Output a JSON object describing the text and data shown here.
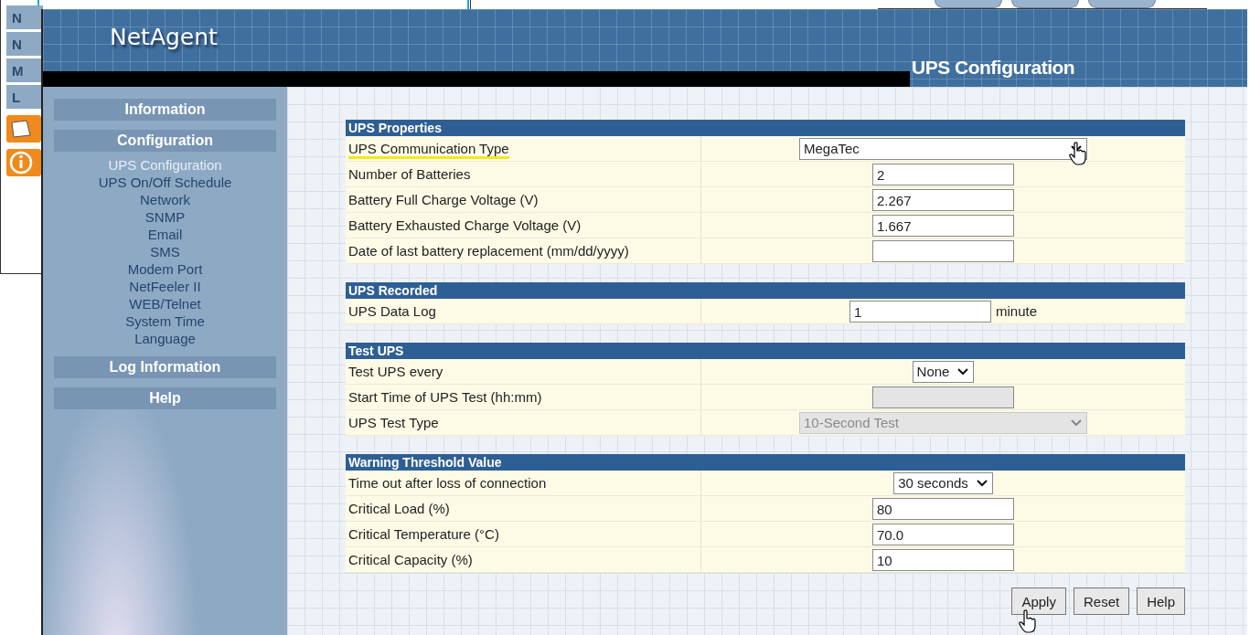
{
  "back_window": {
    "side_items": [
      "N",
      "N",
      "M",
      "L"
    ]
  },
  "header": {
    "logo": "NetAgent",
    "title": "UPS Configuration"
  },
  "sidebar": [
    {
      "label": "Information"
    },
    {
      "label": "Configuration",
      "children": [
        {
          "label": "UPS Configuration",
          "selected": true
        },
        {
          "label": "UPS On/Off Schedule",
          "selected": false
        },
        {
          "label": "Network",
          "selected": false
        },
        {
          "label": "SNMP",
          "selected": false
        },
        {
          "label": "Email",
          "selected": false
        },
        {
          "label": "SMS",
          "selected": false
        },
        {
          "label": "Modem Port",
          "selected": false
        },
        {
          "label": "NetFeeler II",
          "selected": false
        },
        {
          "label": "WEB/Telnet",
          "selected": false
        },
        {
          "label": "System Time",
          "selected": false
        },
        {
          "label": "Language",
          "selected": false
        }
      ]
    },
    {
      "label": "Log Information"
    },
    {
      "label": "Help"
    }
  ],
  "sections": [
    {
      "title": "UPS Properties",
      "rows": [
        {
          "label": "UPS Communication Type",
          "kind": "combo",
          "value": "MegaTec",
          "disabled": false,
          "underlined": true
        },
        {
          "label": "Number of Batteries",
          "kind": "input",
          "value": "2",
          "disabled": false,
          "underlined": false
        },
        {
          "label": "Battery Full Charge Voltage (V)",
          "kind": "input",
          "value": "2.267",
          "disabled": false,
          "underlined": false
        },
        {
          "label": "Battery Exhausted Charge Voltage (V)",
          "kind": "input",
          "value": "1.667",
          "disabled": false,
          "underlined": false
        },
        {
          "label": "Date of last battery replacement (mm/dd/yyyy)",
          "kind": "input",
          "value": "",
          "disabled": false,
          "underlined": false
        }
      ]
    },
    {
      "title": "UPS Recorded",
      "rows": [
        {
          "label": "UPS Data Log",
          "kind": "input",
          "value": "1",
          "unit": "minute",
          "disabled": false,
          "underlined": false
        }
      ]
    },
    {
      "title": "Test UPS",
      "rows": [
        {
          "label": "Test UPS every",
          "kind": "select",
          "value": "None",
          "disabled": false,
          "underlined": false
        },
        {
          "label": "Start Time of UPS Test (hh:mm)",
          "kind": "input",
          "value": "",
          "disabled": true,
          "underlined": false
        },
        {
          "label": "UPS Test Type",
          "kind": "combo",
          "value": "10-Second Test",
          "disabled": true,
          "underlined": false
        }
      ]
    },
    {
      "title": "Warning Threshold Value",
      "rows": [
        {
          "label": "Time out after loss of connection",
          "kind": "select",
          "value": "30 seconds",
          "disabled": false,
          "underlined": false
        },
        {
          "label": "Critical Load (%)",
          "kind": "input",
          "value": "80",
          "disabled": false,
          "underlined": false
        },
        {
          "label": "Critical Temperature (°C)",
          "kind": "input",
          "value": "70.0",
          "disabled": false,
          "underlined": false
        },
        {
          "label": "Critical Capacity (%)",
          "kind": "input",
          "value": "10",
          "disabled": false,
          "underlined": false
        }
      ]
    }
  ],
  "buttons": [
    "Apply",
    "Reset",
    "Help"
  ]
}
